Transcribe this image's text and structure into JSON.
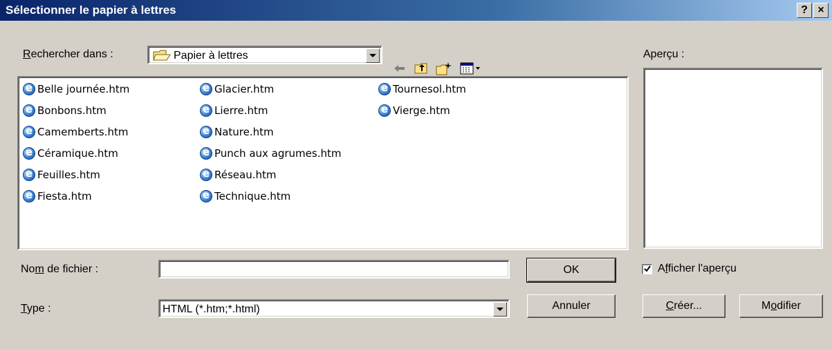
{
  "dialog": {
    "title": "Sélectionner le papier à lettres",
    "help_glyph": "?",
    "close_glyph": "×"
  },
  "look_in": {
    "label_mnemonic": "R",
    "label_rest": "echercher dans :",
    "value": "Papier à lettres"
  },
  "files": [
    "Belle journée.htm",
    "Bonbons.htm",
    "Camemberts.htm",
    "Céramique.htm",
    "Feuilles.htm",
    "Fiesta.htm",
    "Glacier.htm",
    "Lierre.htm",
    "Nature.htm",
    "Punch aux agrumes.htm",
    "Réseau.htm",
    "Technique.htm",
    "Tournesol.htm",
    "Vierge.htm"
  ],
  "preview": {
    "label": "Aperçu :"
  },
  "filename": {
    "label_pre": "No",
    "label_mnemonic": "m",
    "label_post": " de fichier :",
    "value": ""
  },
  "type": {
    "label_mnemonic": "T",
    "label_rest": "ype :",
    "value": "HTML (*.htm;*.html)"
  },
  "buttons": {
    "ok": "OK",
    "cancel": "Annuler",
    "create_mnemonic": "C",
    "create_rest": "réer...",
    "modify_pre": "M",
    "modify_mnemonic": "o",
    "modify_post": "difier"
  },
  "show_preview": {
    "checked": true,
    "label_pre": "A",
    "label_mnemonic": "f",
    "label_post": "ficher l'aperçu"
  },
  "icons": {
    "back": "back-arrow-icon",
    "up": "up-folder-icon",
    "new": "new-folder-icon",
    "view": "view-menu-icon",
    "file": "ie-document-icon"
  }
}
